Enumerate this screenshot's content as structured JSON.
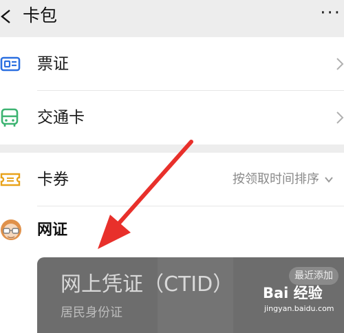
{
  "header": {
    "back": "<",
    "title": "卡包",
    "more": "···"
  },
  "rows": [
    {
      "label": "票证",
      "icon": "ticket-icon"
    },
    {
      "label": "交通卡",
      "icon": "bus-icon"
    },
    {
      "label": "卡券",
      "icon": "coupon-icon",
      "sort_label": "按领取时间排序",
      "sort_icon": "chevron-down-icon"
    }
  ],
  "section": {
    "title": "网证",
    "avatar_icon": "avatar-icon",
    "card": {
      "title": "网上凭证（CTID）",
      "subtitle": "居民身份证",
      "badge": "最近添加"
    }
  },
  "watermark": {
    "logo": "Bai 经验",
    "url": "jingyan.baidu.com"
  },
  "colors": {
    "background": "#ededed",
    "card": "#6d6d6d",
    "ticket_icon": "#2b6fe0",
    "bus_icon": "#3cb371",
    "coupon_icon": "#e8a21a",
    "arrow": "#e8302b"
  }
}
